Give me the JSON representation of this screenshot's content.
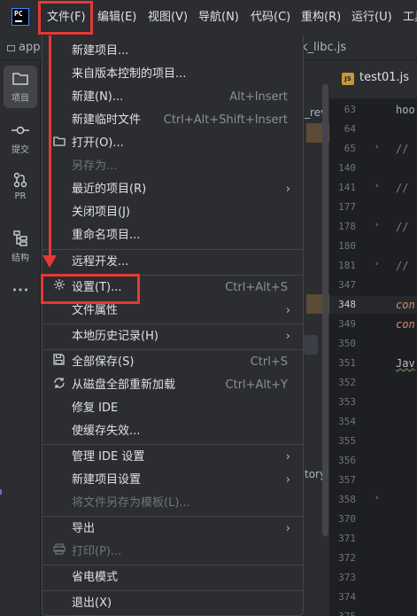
{
  "menubar": {
    "items": [
      {
        "label": "文件(F)"
      },
      {
        "label": "编辑(E)"
      },
      {
        "label": "视图(V)"
      },
      {
        "label": "导航(N)"
      },
      {
        "label": "代码(C)"
      },
      {
        "label": "重构(R)"
      },
      {
        "label": "运行(U)"
      },
      {
        "label": "工具"
      }
    ]
  },
  "background": {
    "tab_left": "app",
    "tab_libc": "k_libc.js",
    "editor_tab": "test01.js",
    "peek_rev": "_rev",
    "peek_tory": "tory",
    "line_numbers": [
      "63",
      "64",
      "65",
      "140",
      "141",
      "177",
      "178",
      "180",
      "181",
      "347",
      "348",
      "349",
      "350",
      "351",
      "352",
      "353",
      "354",
      "355",
      "356",
      "357",
      "358",
      "370",
      "371",
      "372",
      "373",
      "374",
      "375",
      "376"
    ],
    "current_line": "348",
    "code": {
      "hoo": "hoo",
      "comment": "//",
      "con": "con",
      "jav": "Jav"
    }
  },
  "toolstrip": {
    "project": "项目",
    "commit": "提交",
    "pr": "PR",
    "structure": "结构",
    "more": "•••"
  },
  "file_menu": {
    "new_project": "新建项目...",
    "from_vcs": "来自版本控制的项目...",
    "new": "新建(N)...",
    "new_shortcut": "Alt+Insert",
    "new_scratch": "新建临时文件",
    "new_scratch_shortcut": "Ctrl+Alt+Shift+Insert",
    "open": "打开(O)...",
    "save_as": "另存为...",
    "recent_projects": "最近的项目(R)",
    "close_project": "关闭项目(J)",
    "rename_project": "重命名项目...",
    "remote_dev": "远程开发...",
    "settings": "设置(T)...",
    "settings_shortcut": "Ctrl+Alt+S",
    "file_properties": "文件属性",
    "local_history": "本地历史记录(H)",
    "save_all": "全部保存(S)",
    "save_all_shortcut": "Ctrl+S",
    "reload_all": "从磁盘全部重新加载",
    "reload_all_shortcut": "Ctrl+Alt+Y",
    "repair_ide": "修复 IDE",
    "invalidate_caches": "使缓存失效...",
    "manage_ide_settings": "管理 IDE 设置",
    "new_project_settings": "新建项目设置",
    "save_as_template": "将文件另存为模板(L)...",
    "export": "导出",
    "print": "打印(P)...",
    "power_save": "省电模式",
    "exit": "退出(X)"
  },
  "icons": {
    "open": "folder-icon",
    "settings": "gear-icon",
    "save_all": "save-icon",
    "reload_all": "reload-icon",
    "print": "printer-icon",
    "submenu": "chevron-right-icon"
  },
  "colors": {
    "highlight": "#e53935",
    "menu_bg": "#2b2d30",
    "editor_bg": "#1e1f22"
  }
}
